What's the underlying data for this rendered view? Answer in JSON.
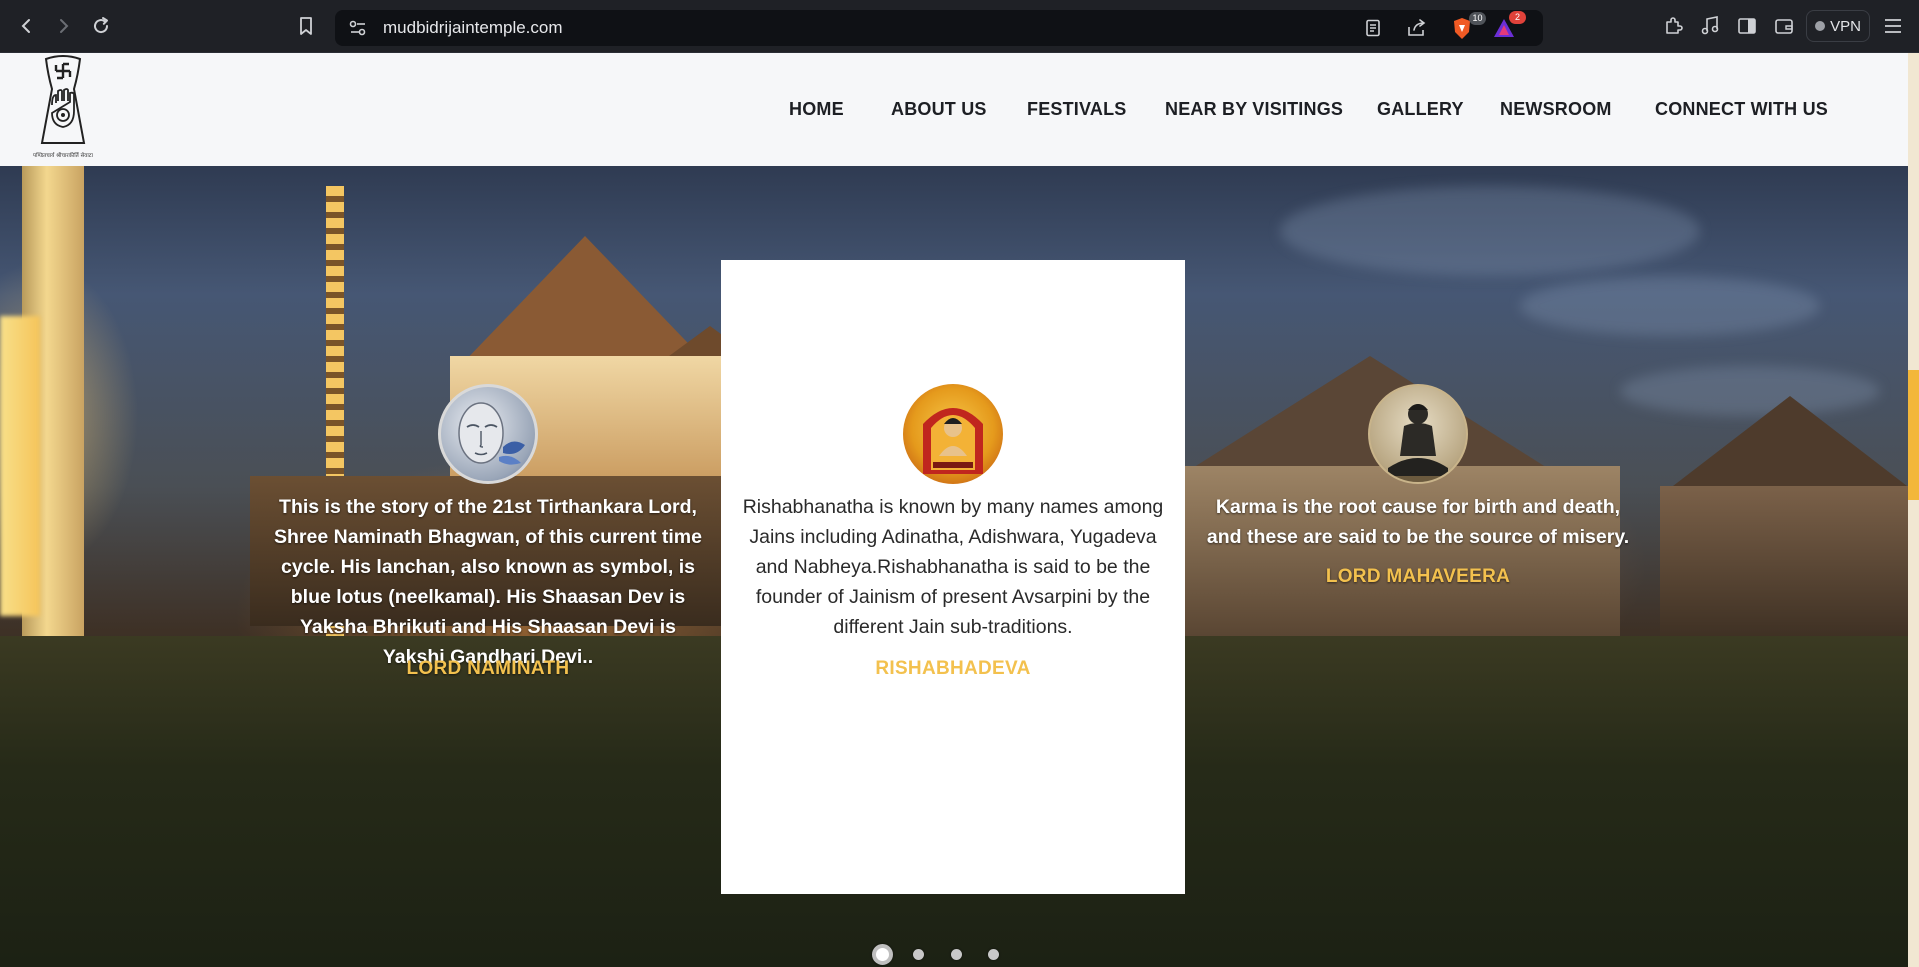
{
  "browser": {
    "url": "mudbidrijaintemple.com",
    "shield_count": "10",
    "rewards_count": "2",
    "vpn_label": "VPN"
  },
  "site": {
    "logo_caption": "पण्डितचार्य श्रीचारकीर्ति सेवाटा",
    "nav": [
      "HOME",
      "ABOUT US",
      "FESTIVALS",
      "NEAR BY VISITINGS",
      "GALLERY",
      "NEWSROOM",
      "CONNECT WITH US"
    ]
  },
  "slider": {
    "slides": [
      {
        "text": "This is the story of the 21st Tirthankara Lord, Shree Naminath Bhagwan, of this current time cycle. His lanchan, also known as symbol, is blue lotus (neelkamal). His Shaasan Dev is Yaksha Bhrikuti and His Shaasan Devi is Yakshi Gandhari Devi..",
        "title": "LORD NAMINATH"
      },
      {
        "text": "Rishabhanatha is known by many names among Jains including Adinatha, Adishwara, Yugadeva and Nabheya.Rishabhanatha is said to be the founder of Jainism of present Avsarpini by the different Jain sub-traditions.",
        "title": "RISHABHADEVA"
      },
      {
        "text": "Karma is the root cause for birth and death, and these are said to be the source of misery.",
        "title": "LORD MAHAVEERA"
      }
    ],
    "active_dot": 1,
    "dot_count": 4
  },
  "colors": {
    "accent": "#f3c14e",
    "header_bg": "#f6f7f9",
    "scrollbar_thumb": "#f3b73b"
  }
}
